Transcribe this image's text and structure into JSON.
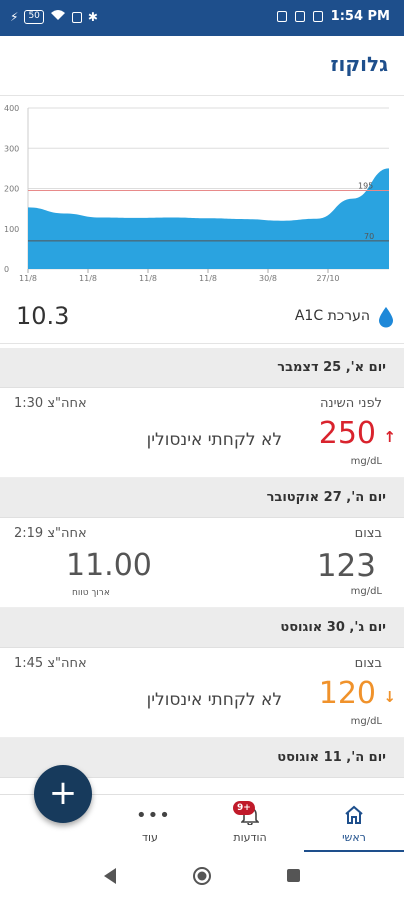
{
  "status_bar": {
    "time": "1:54 PM",
    "battery": "50"
  },
  "header": {
    "title": "גלוקוז"
  },
  "chart_data": {
    "type": "area",
    "x_labels": [
      "11/8",
      "11/8",
      "11/8",
      "11/8",
      "30/8",
      "27/10"
    ],
    "y_ticks": [
      "400",
      "300",
      "200",
      "100",
      "0"
    ],
    "ylim": [
      0,
      400
    ],
    "series": [
      {
        "values": [
          153,
          138,
          128,
          127,
          128,
          126,
          124,
          120,
          125,
          175,
          250
        ]
      }
    ],
    "high_line": {
      "value": 195,
      "label": "195"
    },
    "low_line": {
      "value": 70,
      "label": "70"
    },
    "colors": {
      "fill": "#2aa3e0",
      "high_line": "#e88a8a",
      "low_line": "#555555"
    }
  },
  "a1c": {
    "value": "10.3",
    "label": "הערכת A1C",
    "icon": "drop-icon"
  },
  "days": [
    {
      "header": "יום א', 25 דצמבר",
      "entries": [
        {
          "type": "לפני השינה",
          "time": "1:30 אחה\"צ",
          "value": "250",
          "unit": "mg/dL",
          "note": "לא לקחתי אינסולין",
          "arrow": "↑",
          "color": "#d9232d"
        }
      ]
    },
    {
      "header": "יום ה', 27 אוקטובר",
      "entries": [
        {
          "type": "בצום",
          "time": "2:19 אחה\"צ",
          "value": "123",
          "unit": "mg/dL",
          "carb_value": "11.00",
          "carb_label": "ארוך טווח"
        }
      ]
    },
    {
      "header": "יום ג', 30 אוגוסט",
      "entries": [
        {
          "type": "בצום",
          "time": "1:45 אחה\"צ",
          "value": "120",
          "unit": "mg/dL",
          "note": "לא לקחתי אינסולין",
          "arrow": "↓",
          "color": "#f0922b"
        }
      ]
    },
    {
      "header": "יום ה', 11 אוגוסט",
      "entries": []
    }
  ],
  "bottom_nav": {
    "home": "ראשי",
    "notifications": "הודעות",
    "notifications_badge": "9+",
    "more": "עוד"
  },
  "fab": {
    "label": "+"
  }
}
